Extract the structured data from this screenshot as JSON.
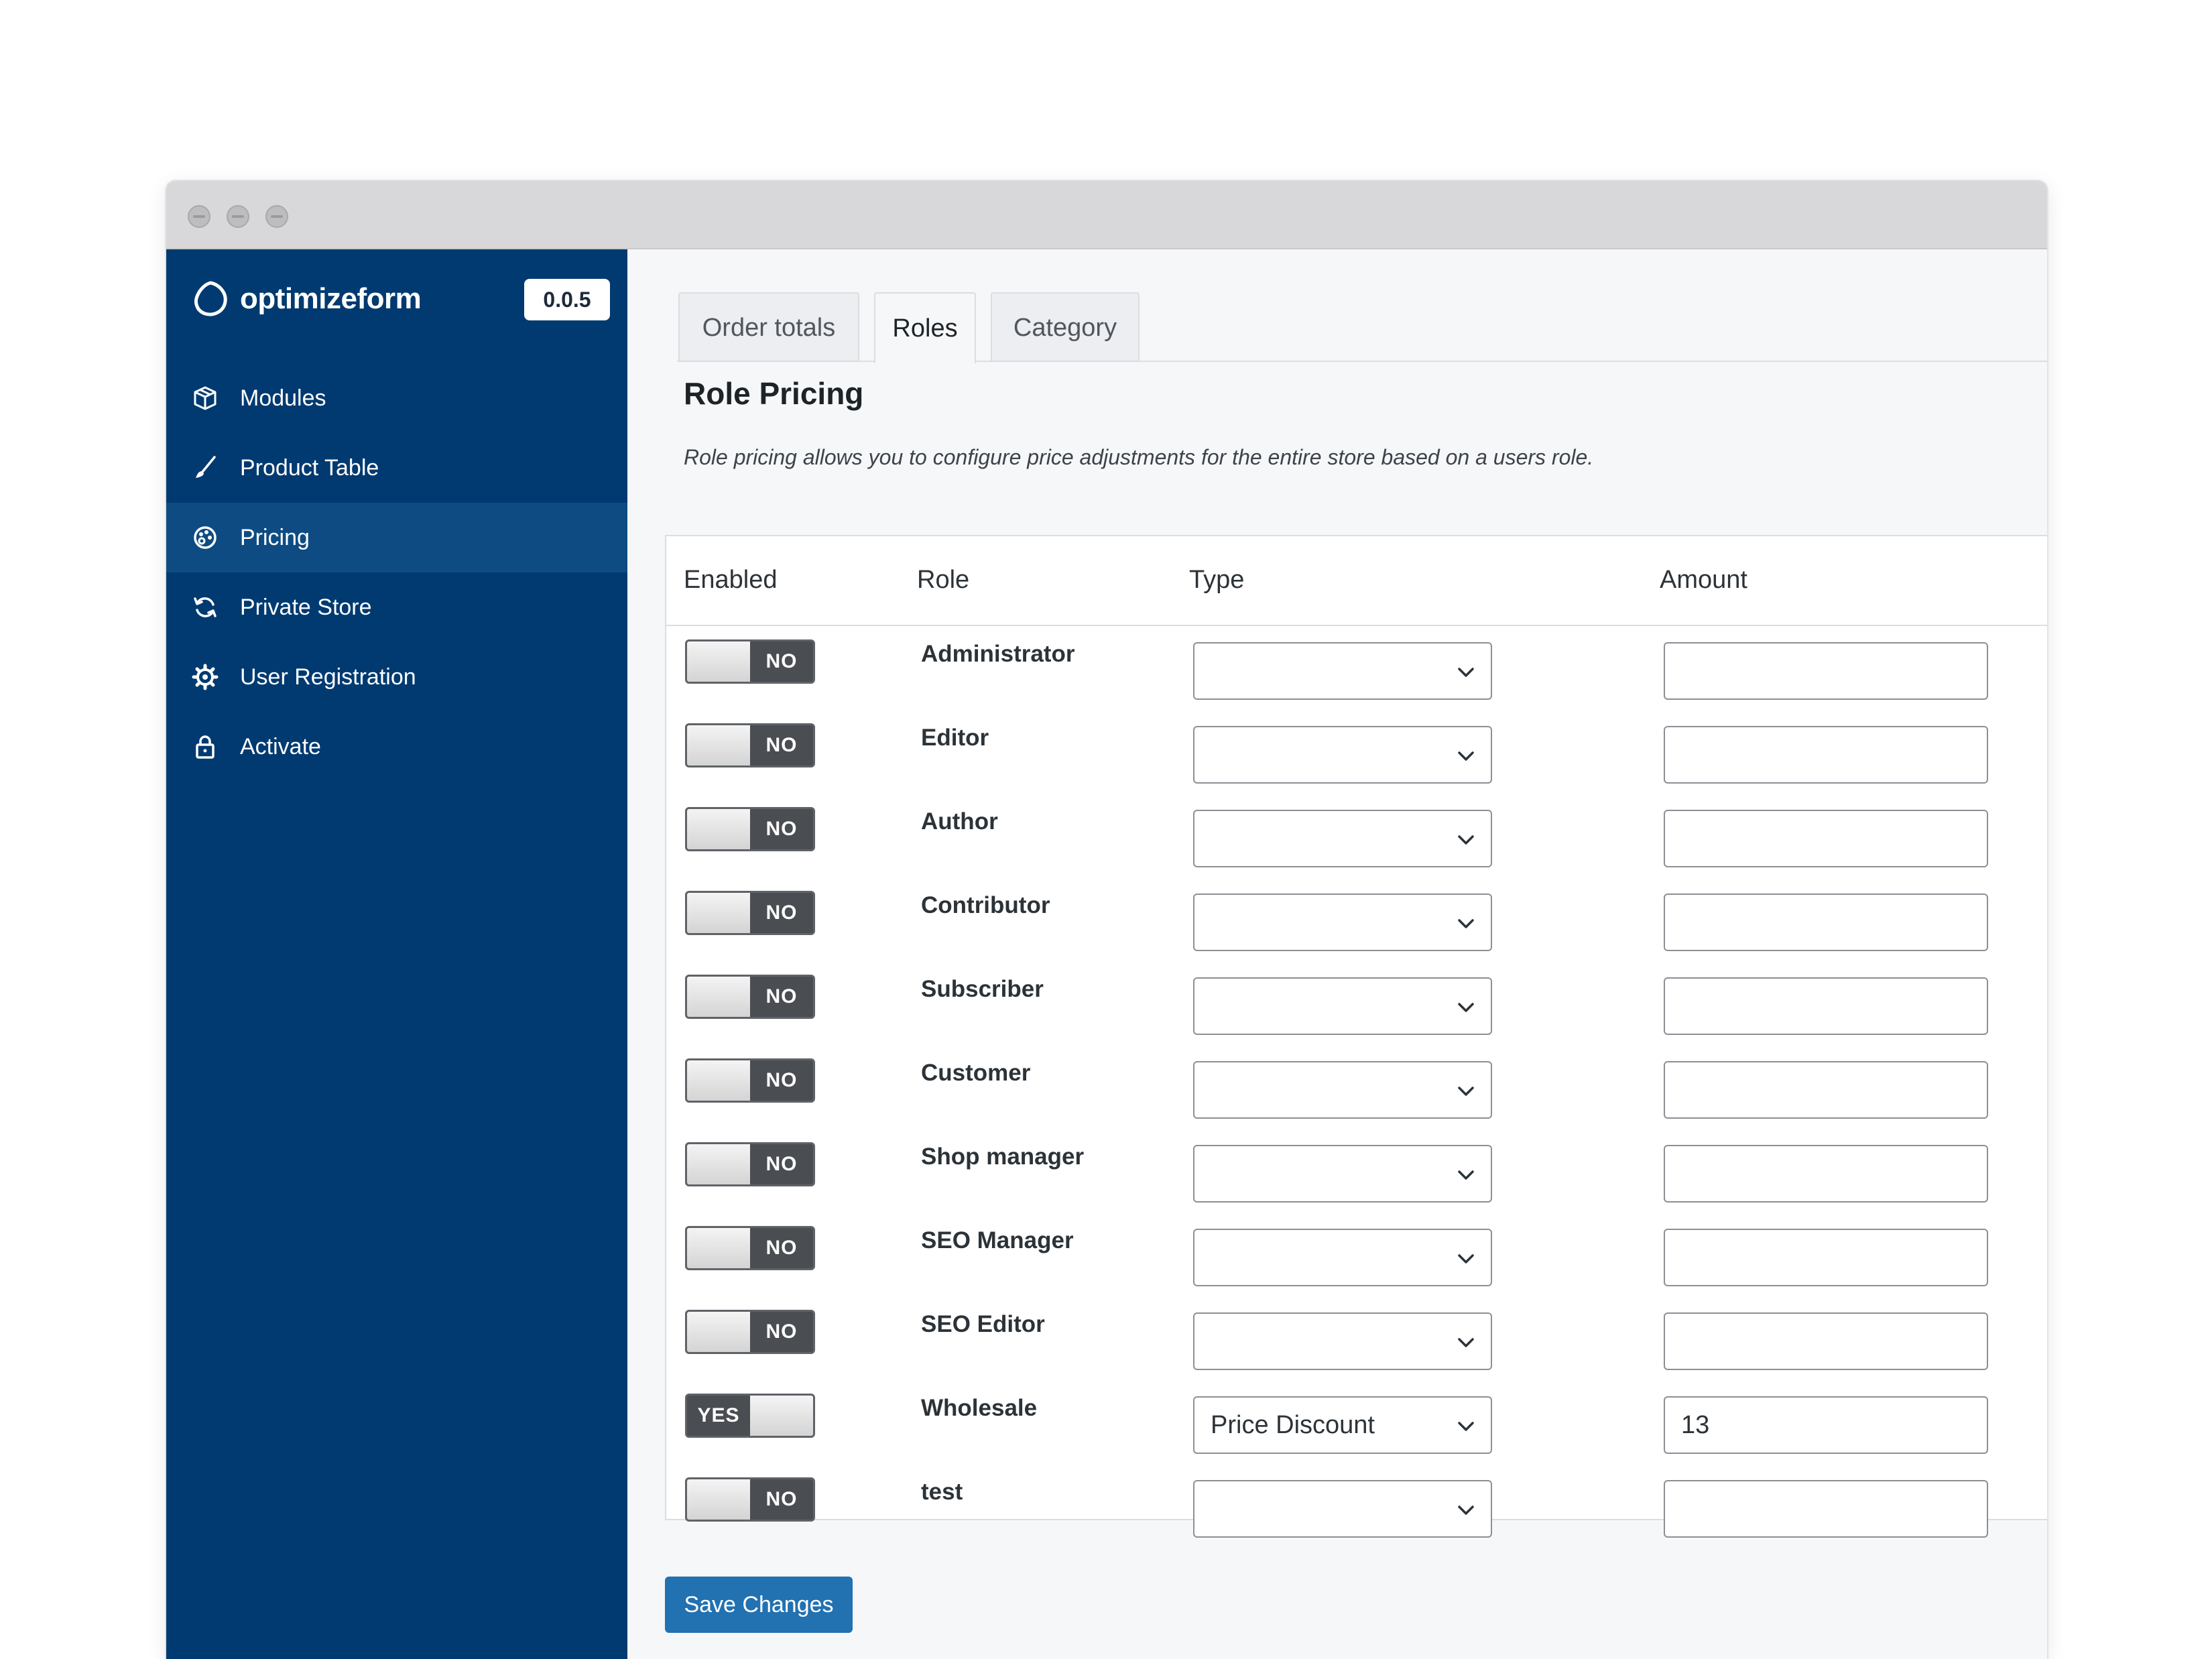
{
  "app": {
    "brand_name": "optimizeform",
    "version": "0.0.5",
    "accent_color": "#003a70",
    "button_color": "#2271b1"
  },
  "sidebar": {
    "items": [
      {
        "label": "Modules",
        "icon": "cube-icon",
        "active": false
      },
      {
        "label": "Product Table",
        "icon": "brush-icon",
        "active": false
      },
      {
        "label": "Pricing",
        "icon": "palette-icon",
        "active": true
      },
      {
        "label": "Private Store",
        "icon": "refresh-icon",
        "active": false
      },
      {
        "label": "User Registration",
        "icon": "gear-icon",
        "active": false
      },
      {
        "label": "Activate",
        "icon": "lock-icon",
        "active": false
      }
    ]
  },
  "tabs": [
    {
      "label": "Order totals",
      "active": false
    },
    {
      "label": "Roles",
      "active": true
    },
    {
      "label": "Category",
      "active": false
    }
  ],
  "section": {
    "title": "Role Pricing",
    "description": "Role pricing allows you to configure price adjustments for the entire store based on a users role."
  },
  "table": {
    "headers": {
      "enabled": "Enabled",
      "role": "Role",
      "type": "Type",
      "amount": "Amount"
    },
    "rows": [
      {
        "role": "Administrator",
        "enabled": false,
        "toggle_label": "NO",
        "type": "",
        "amount": ""
      },
      {
        "role": "Editor",
        "enabled": false,
        "toggle_label": "NO",
        "type": "",
        "amount": ""
      },
      {
        "role": "Author",
        "enabled": false,
        "toggle_label": "NO",
        "type": "",
        "amount": ""
      },
      {
        "role": "Contributor",
        "enabled": false,
        "toggle_label": "NO",
        "type": "",
        "amount": ""
      },
      {
        "role": "Subscriber",
        "enabled": false,
        "toggle_label": "NO",
        "type": "",
        "amount": ""
      },
      {
        "role": "Customer",
        "enabled": false,
        "toggle_label": "NO",
        "type": "",
        "amount": ""
      },
      {
        "role": "Shop manager",
        "enabled": false,
        "toggle_label": "NO",
        "type": "",
        "amount": ""
      },
      {
        "role": "SEO Manager",
        "enabled": false,
        "toggle_label": "NO",
        "type": "",
        "amount": ""
      },
      {
        "role": "SEO Editor",
        "enabled": false,
        "toggle_label": "NO",
        "type": "",
        "amount": ""
      },
      {
        "role": "Wholesale",
        "enabled": true,
        "toggle_label": "YES",
        "type": "Price Discount",
        "amount": "13"
      },
      {
        "role": "test",
        "enabled": false,
        "toggle_label": "NO",
        "type": "",
        "amount": ""
      }
    ]
  },
  "actions": {
    "save_label": "Save Changes"
  }
}
